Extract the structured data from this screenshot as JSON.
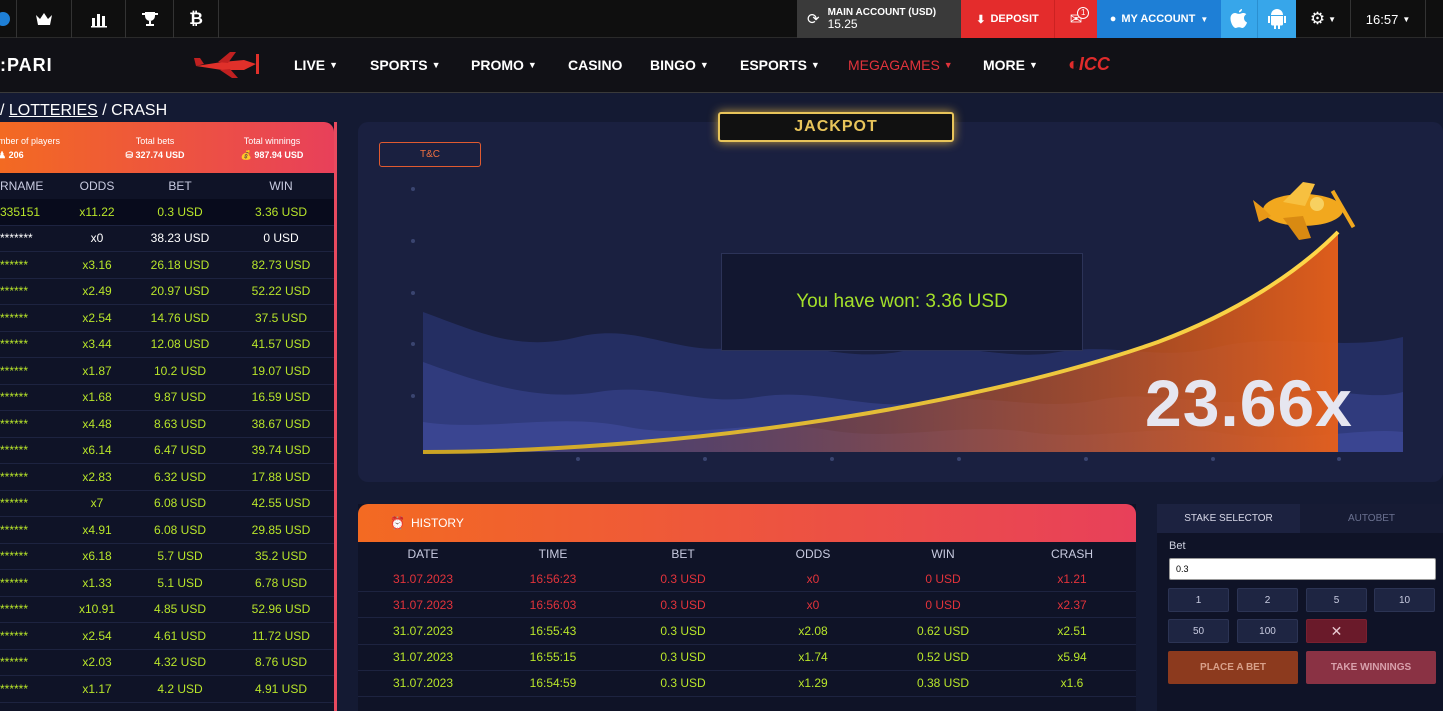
{
  "topbar": {
    "account_label": "MAIN ACCOUNT (USD)",
    "balance": "15.25",
    "deposit_label": "DEPOSIT",
    "mail_badge": "1",
    "my_account_label": "MY ACCOUNT",
    "time": "16:57"
  },
  "nav": {
    "logo": ":PARI",
    "items": [
      "LIVE",
      "SPORTS",
      "PROMO",
      "CASINO",
      "BINGO",
      "ESPORTS",
      "MEGAGAMES",
      "MORE"
    ],
    "icc": "ICC"
  },
  "breadcrumb": {
    "part1": "LOTTERIES",
    "part2": "CRASH"
  },
  "stats": {
    "players_label": "mber of players",
    "players_value": "206",
    "bets_label": "Total bets",
    "bets_value": "327.74 USD",
    "winnings_label": "Total winnings",
    "winnings_value": "987.94 USD"
  },
  "players_table": {
    "headers": [
      "RNAME",
      "ODDS",
      "BET",
      "WIN"
    ],
    "rows": [
      [
        "335151",
        "x11.22",
        "0.3 USD",
        "3.36 USD"
      ],
      [
        "*******",
        "x0",
        "38.23 USD",
        "0 USD"
      ],
      [
        "******",
        "x3.16",
        "26.18 USD",
        "82.73 USD"
      ],
      [
        "******",
        "x2.49",
        "20.97 USD",
        "52.22 USD"
      ],
      [
        "******",
        "x2.54",
        "14.76 USD",
        "37.5 USD"
      ],
      [
        "******",
        "x3.44",
        "12.08 USD",
        "41.57 USD"
      ],
      [
        "******",
        "x1.87",
        "10.2 USD",
        "19.07 USD"
      ],
      [
        "******",
        "x1.68",
        "9.87 USD",
        "16.59 USD"
      ],
      [
        "******",
        "x4.48",
        "8.63 USD",
        "38.67 USD"
      ],
      [
        "******",
        "x6.14",
        "6.47 USD",
        "39.74 USD"
      ],
      [
        "******",
        "x2.83",
        "6.32 USD",
        "17.88 USD"
      ],
      [
        "******",
        "x7",
        "6.08 USD",
        "42.55 USD"
      ],
      [
        "******",
        "x4.91",
        "6.08 USD",
        "29.85 USD"
      ],
      [
        "******",
        "x6.18",
        "5.7 USD",
        "35.2 USD"
      ],
      [
        "******",
        "x1.33",
        "5.1 USD",
        "6.78 USD"
      ],
      [
        "******",
        "x10.91",
        "4.85 USD",
        "52.96 USD"
      ],
      [
        "******",
        "x2.54",
        "4.61 USD",
        "11.72 USD"
      ],
      [
        "******",
        "x2.03",
        "4.32 USD",
        "8.76 USD"
      ],
      [
        "******",
        "x1.17",
        "4.2 USD",
        "4.91 USD"
      ]
    ]
  },
  "game": {
    "jackpot": "JACKPOT",
    "tc": "T&C",
    "won_message": "You have won: 3.36 USD",
    "multiplier": "23.66x"
  },
  "history": {
    "title": "HISTORY",
    "headers": [
      "DATE",
      "TIME",
      "BET",
      "ODDS",
      "WIN",
      "CRASH"
    ],
    "rows": [
      {
        "cells": [
          "31.07.2023",
          "16:56:23",
          "0.3 USD",
          "x0",
          "0 USD",
          "x1.21"
        ],
        "status": "lost"
      },
      {
        "cells": [
          "31.07.2023",
          "16:56:03",
          "0.3 USD",
          "x0",
          "0 USD",
          "x2.37"
        ],
        "status": "lost"
      },
      {
        "cells": [
          "31.07.2023",
          "16:55:43",
          "0.3 USD",
          "x2.08",
          "0.62 USD",
          "x2.51"
        ],
        "status": "win"
      },
      {
        "cells": [
          "31.07.2023",
          "16:55:15",
          "0.3 USD",
          "x1.74",
          "0.52 USD",
          "x5.94"
        ],
        "status": "win"
      },
      {
        "cells": [
          "31.07.2023",
          "16:54:59",
          "0.3 USD",
          "x1.29",
          "0.38 USD",
          "x1.6"
        ],
        "status": "win"
      }
    ]
  },
  "stake": {
    "tab_selector": "STAKE SELECTOR",
    "tab_autobet": "AUTOBET",
    "bet_label": "Bet",
    "bet_value": "0.3",
    "quick": [
      "1",
      "2",
      "5",
      "10",
      "50",
      "100"
    ],
    "clear": "✕",
    "place_bet": "PLACE A BET",
    "take_winnings": "TAKE WINNINGS"
  },
  "colors": {
    "accent_orange": "#f36a22",
    "accent_red": "#e8405a",
    "win_green": "#b9e62a",
    "loss_red": "#e2333b",
    "brand_blue": "#1e7fd6"
  }
}
